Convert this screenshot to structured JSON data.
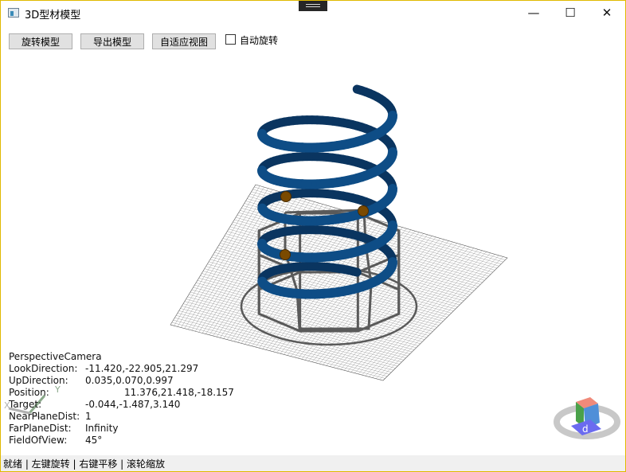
{
  "window": {
    "title": "3D型材模型"
  },
  "controls": {
    "minimize": "—",
    "maximize": "☐",
    "close": "✕"
  },
  "toolbar": {
    "rotate_model": "旋转模型",
    "export_model": "导出模型",
    "fit_view": "自适应视图",
    "auto_rotate_label": "自动旋转",
    "auto_rotate_checked": false
  },
  "camera": {
    "type": "PerspectiveCamera",
    "rows": [
      {
        "label": "LookDirection:",
        "value": "-11.420,-22.905,21.297"
      },
      {
        "label": "UpDirection:",
        "value": "0.035,0.070,0.997"
      },
      {
        "label": "Position:",
        "value": "11.376,21.418,-18.157"
      },
      {
        "label": "Target:",
        "value": "-0.044,-1.487,3.140"
      },
      {
        "label": "NearPlaneDist:",
        "value": "1"
      },
      {
        "label": "FarPlaneDist:",
        "value": "Infinity"
      },
      {
        "label": "FieldOfView:",
        "value": "45°"
      }
    ]
  },
  "axes": {
    "y_label": "Y",
    "x_label": "X"
  },
  "view_cube": {
    "face_label": "d"
  },
  "status": {
    "text": "就绪 | 左键旋转 | 右键平移 | 滚轮缩放"
  },
  "colors": {
    "helix": "#0e4d86",
    "helix_dark": "#0a3560",
    "frame": "#5a5a5a",
    "grid": "#555555",
    "markers": "#7a4a00"
  }
}
